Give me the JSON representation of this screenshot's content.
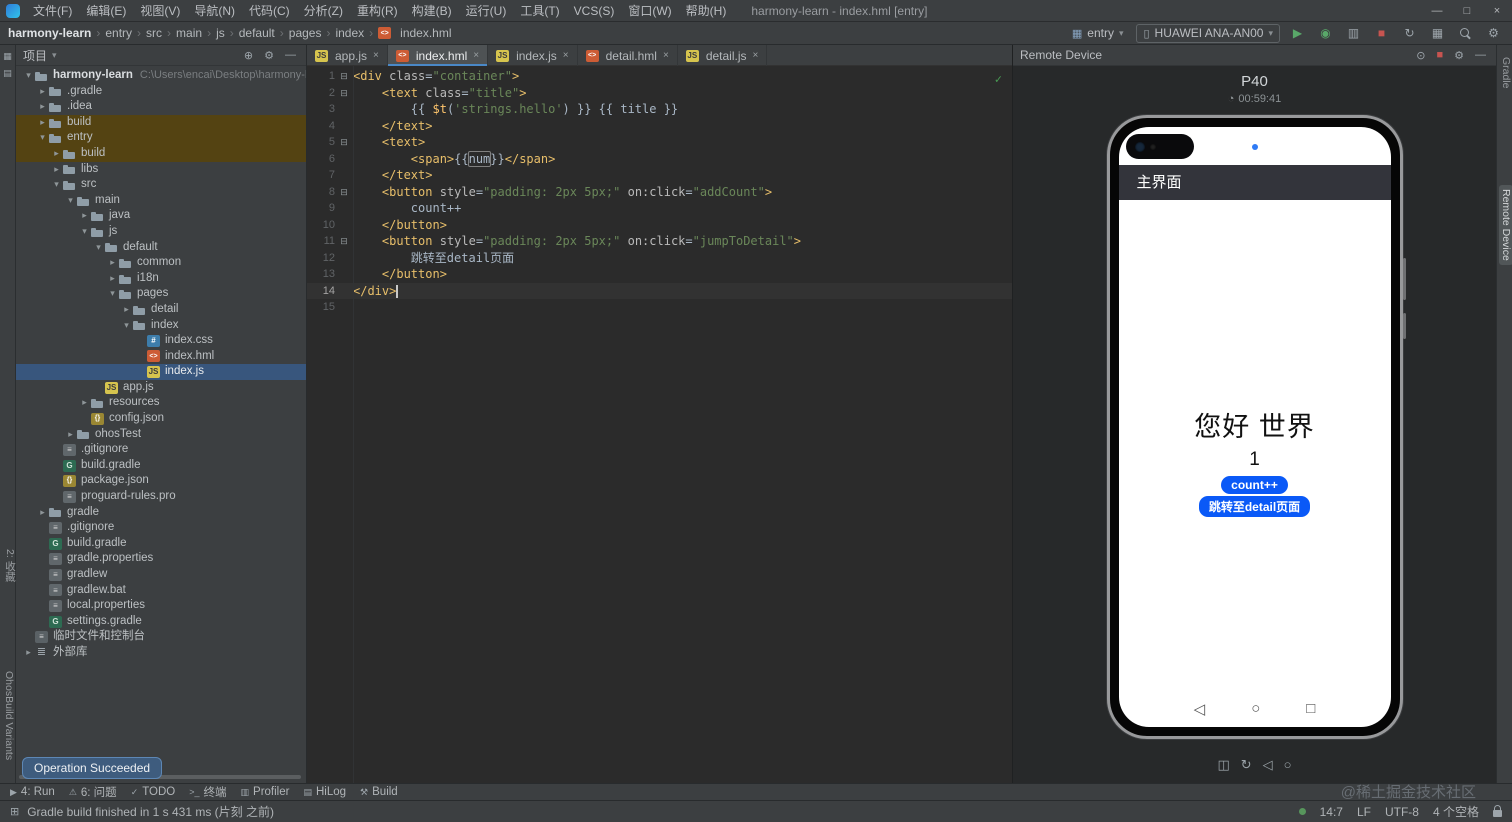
{
  "colors": {
    "accent_blue": "#4a88c7",
    "run_green": "#59a869",
    "stop_red": "#c75450",
    "harmony_button_blue": "#0a59f7",
    "build_row_highlight": "#544312",
    "selected_row": "#38567d"
  },
  "icons": {
    "chevron-down": "▾",
    "chevron-right": "▸",
    "minimize": "—",
    "maximize": "□",
    "close": "×",
    "run": "▶",
    "debug": "◉",
    "profiler": "▥",
    "stop": "■",
    "sync": "↻",
    "settings": "⚙",
    "gear": "⚙",
    "hide": "—",
    "pin": "⊙",
    "locate": "⊕",
    "device": "▯",
    "module": "▦",
    "grid": "▦",
    "rows": "▤",
    "clock": "◔",
    "back": "◁",
    "home": "○",
    "recents": "□",
    "rotate": "↻",
    "capture": "◫",
    "problems": "⚠",
    "todo": "✓",
    "terminal": ">_",
    "hilog": "▤",
    "build": "⚒",
    "fold": "⊟",
    "check": "✓",
    "corner": "⊞",
    "file-js": "JS",
    "file-css": "#",
    "file-hml": "<>",
    "file-json": "{}",
    "file-text": "≡",
    "file-gradle": "G",
    "file-lib": "≣",
    "file-scratch": "≡"
  },
  "title_bar": {
    "title": "harmony-learn - index.hml [entry]",
    "menus": [
      "文件(F)",
      "编辑(E)",
      "视图(V)",
      "导航(N)",
      "代码(C)",
      "分析(Z)",
      "重构(R)",
      "构建(B)",
      "运行(U)",
      "工具(T)",
      "VCS(S)",
      "窗口(W)",
      "帮助(H)"
    ]
  },
  "nav_bar": {
    "breadcrumbs": [
      "harmony-learn",
      "entry",
      "src",
      "main",
      "js",
      "default",
      "pages",
      "index",
      "index.hml"
    ],
    "run_config": "entry",
    "device": "HUAWEI ANA-AN00"
  },
  "project": {
    "panel_title": "项目",
    "tree": [
      {
        "label": "harmony-learn",
        "hint": "C:\\Users\\encai\\Desktop\\harmony-learn",
        "level": 0,
        "icon": "project",
        "chev": "open"
      },
      {
        "label": ".gradle",
        "level": 1,
        "icon": "folder",
        "chev": "closed"
      },
      {
        "label": ".idea",
        "level": 1,
        "icon": "folder",
        "chev": "closed"
      },
      {
        "label": "build",
        "level": 1,
        "icon": "folder",
        "chev": "closed",
        "hl": true
      },
      {
        "label": "entry",
        "level": 1,
        "icon": "module",
        "chev": "open",
        "hl": true
      },
      {
        "label": "build",
        "level": 2,
        "icon": "folder",
        "chev": "closed",
        "hl": true
      },
      {
        "label": "libs",
        "level": 2,
        "icon": "folder",
        "chev": "closed"
      },
      {
        "label": "src",
        "level": 2,
        "icon": "folder",
        "chev": "open"
      },
      {
        "label": "main",
        "level": 3,
        "icon": "folder",
        "chev": "open"
      },
      {
        "label": "java",
        "level": 4,
        "icon": "folder",
        "chev": "closed"
      },
      {
        "label": "js",
        "level": 4,
        "icon": "folder",
        "chev": "open"
      },
      {
        "label": "default",
        "level": 5,
        "icon": "folder",
        "chev": "open"
      },
      {
        "label": "common",
        "level": 6,
        "icon": "folder",
        "chev": "closed"
      },
      {
        "label": "i18n",
        "level": 6,
        "icon": "folder",
        "chev": "closed"
      },
      {
        "label": "pages",
        "level": 6,
        "icon": "folder",
        "chev": "open"
      },
      {
        "label": "detail",
        "level": 7,
        "icon": "folder",
        "chev": "closed"
      },
      {
        "label": "index",
        "level": 7,
        "icon": "folder",
        "chev": "open"
      },
      {
        "label": "index.css",
        "level": 8,
        "icon": "css"
      },
      {
        "label": "index.hml",
        "level": 8,
        "icon": "hml"
      },
      {
        "label": "index.js",
        "level": 8,
        "icon": "js",
        "selected": true
      },
      {
        "label": "app.js",
        "level": 5,
        "icon": "js"
      },
      {
        "label": "resources",
        "level": 4,
        "icon": "folder",
        "chev": "closed"
      },
      {
        "label": "config.json",
        "level": 4,
        "icon": "json"
      },
      {
        "label": "ohosTest",
        "level": 3,
        "icon": "folder",
        "chev": "closed"
      },
      {
        "label": ".gitignore",
        "level": 2,
        "icon": "text"
      },
      {
        "label": "build.gradle",
        "level": 2,
        "icon": "gradle"
      },
      {
        "label": "package.json",
        "level": 2,
        "icon": "json"
      },
      {
        "label": "proguard-rules.pro",
        "level": 2,
        "icon": "text"
      },
      {
        "label": "gradle",
        "level": 1,
        "icon": "folder",
        "chev": "closed"
      },
      {
        "label": ".gitignore",
        "level": 1,
        "icon": "text"
      },
      {
        "label": "build.gradle",
        "level": 1,
        "icon": "gradle"
      },
      {
        "label": "gradle.properties",
        "level": 1,
        "icon": "text"
      },
      {
        "label": "gradlew",
        "level": 1,
        "icon": "text"
      },
      {
        "label": "gradlew.bat",
        "level": 1,
        "icon": "text"
      },
      {
        "label": "local.properties",
        "level": 1,
        "icon": "text"
      },
      {
        "label": "settings.gradle",
        "level": 1,
        "icon": "gradle"
      },
      {
        "label": "临时文件和控制台",
        "level": 0,
        "icon": "scratch"
      },
      {
        "label": "外部库",
        "level": 0,
        "icon": "lib",
        "chev": "closed"
      }
    ]
  },
  "editor": {
    "tabs": [
      {
        "label": "app.js",
        "icon": "js"
      },
      {
        "label": "index.hml",
        "icon": "hml",
        "active": true
      },
      {
        "label": "index.js",
        "icon": "js"
      },
      {
        "label": "detail.hml",
        "icon": "hml"
      },
      {
        "label": "detail.js",
        "icon": "js"
      }
    ],
    "fold_lines": [
      1,
      2,
      5,
      8,
      11
    ],
    "caret_line": 14,
    "lines": [
      [
        [
          "<div",
          "tag"
        ],
        [
          " ",
          "pl"
        ],
        [
          "class",
          "attr"
        ],
        [
          "=",
          "pl"
        ],
        [
          "\"container\"",
          "str"
        ],
        [
          ">",
          "tag"
        ]
      ],
      [
        [
          "    ",
          "pl"
        ],
        [
          "<text",
          "tag"
        ],
        [
          " ",
          "pl"
        ],
        [
          "class",
          "attr"
        ],
        [
          "=",
          "pl"
        ],
        [
          "\"title\"",
          "str"
        ],
        [
          ">",
          "tag"
        ]
      ],
      [
        [
          "        ",
          "pl"
        ],
        [
          "{{ ",
          "pl"
        ],
        [
          "$t",
          "func"
        ],
        [
          "(",
          "pl"
        ],
        [
          "'strings.hello'",
          "str"
        ],
        [
          ")",
          "pl"
        ],
        [
          " }} {{ title }}",
          "pl"
        ]
      ],
      [
        [
          "    ",
          "pl"
        ],
        [
          "</text>",
          "tag"
        ]
      ],
      [
        [
          "    ",
          "pl"
        ],
        [
          "<text>",
          "tag"
        ]
      ],
      [
        [
          "        ",
          "pl"
        ],
        [
          "<span>",
          "tag"
        ],
        [
          "{{",
          "pl"
        ],
        [
          "num",
          "boxed"
        ],
        [
          "}}",
          "pl"
        ],
        [
          "</span>",
          "tag"
        ]
      ],
      [
        [
          "    ",
          "pl"
        ],
        [
          "</text>",
          "tag"
        ]
      ],
      [
        [
          "    ",
          "pl"
        ],
        [
          "<button",
          "tag"
        ],
        [
          " ",
          "pl"
        ],
        [
          "style",
          "attr"
        ],
        [
          "=",
          "pl"
        ],
        [
          "\"padding: 2px 5px;\"",
          "str"
        ],
        [
          " ",
          "pl"
        ],
        [
          "on:click",
          "attr"
        ],
        [
          "=",
          "pl"
        ],
        [
          "\"addCount\"",
          "str"
        ],
        [
          ">",
          "tag"
        ]
      ],
      [
        [
          "        count++",
          "pl"
        ]
      ],
      [
        [
          "    ",
          "pl"
        ],
        [
          "</button>",
          "tag"
        ]
      ],
      [
        [
          "    ",
          "pl"
        ],
        [
          "<button",
          "tag"
        ],
        [
          " ",
          "pl"
        ],
        [
          "style",
          "attr"
        ],
        [
          "=",
          "pl"
        ],
        [
          "\"padding: 2px 5px;\"",
          "str"
        ],
        [
          " ",
          "pl"
        ],
        [
          "on:click",
          "attr"
        ],
        [
          "=",
          "pl"
        ],
        [
          "\"jumpToDetail\"",
          "str"
        ],
        [
          ">",
          "tag"
        ]
      ],
      [
        [
          "        跳转至detail页面",
          "pl"
        ]
      ],
      [
        [
          "    ",
          "pl"
        ],
        [
          "</button>",
          "tag"
        ]
      ],
      [
        [
          "</div>",
          "tag"
        ]
      ],
      []
    ]
  },
  "remote": {
    "panel_title": "Remote Device",
    "device_name": "P40",
    "timer": "00:59:41",
    "app_title": "主界面",
    "greeting": "您好 世界",
    "counter": "1",
    "btn_count": "count++",
    "btn_jump": "跳转至detail页面"
  },
  "rails": {
    "left": [
      "2: 收藏",
      "OhosBuild Variants"
    ],
    "right": [
      "Gradle",
      "Remote Device"
    ]
  },
  "status_bar": {
    "tools": [
      {
        "icon": "run",
        "label": "4: Run"
      },
      {
        "icon": "problems",
        "label": "6: 问题"
      },
      {
        "icon": "todo",
        "label": "TODO"
      },
      {
        "icon": "terminal",
        "label": "终端"
      },
      {
        "icon": "profiler",
        "label": "Profiler"
      },
      {
        "icon": "hilog",
        "label": "HiLog"
      },
      {
        "icon": "build",
        "label": "Build"
      }
    ],
    "message": "Gradle build finished in 1 s 431 ms (片刻 之前)",
    "position": "14:7",
    "line_sep": "LF",
    "encoding": "UTF-8",
    "indent": "4 个空格"
  },
  "popup": {
    "text": "Operation Succeeded"
  },
  "watermark": "@稀土掘金技术社区"
}
